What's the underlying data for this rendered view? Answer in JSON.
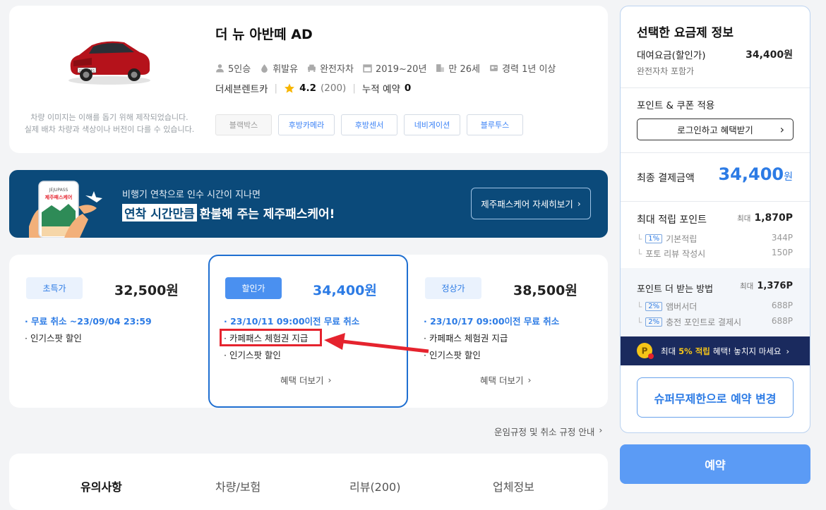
{
  "car": {
    "title": "더 뉴 아반떼 AD",
    "disclaimer_1": "차량 이미지는 이해를 돕기 위해 제작되었습니다.",
    "disclaimer_2": "실제 배차 차량과 색상이나 버전이 다를 수 있습니다.",
    "plate": "22호 2061",
    "specs": [
      "5인승",
      "휘발유",
      "완전자차",
      "2019~20년",
      "만 26세",
      "경력 1년 이상"
    ],
    "company": "더세븐렌트카",
    "rating": "4.2",
    "reviews": "(200)",
    "reservations_label": "누적 예약",
    "reservations_count": "0",
    "tags": [
      "블랙박스",
      "후방카메라",
      "후방센서",
      "네비게이션",
      "블루투스"
    ]
  },
  "banner": {
    "sub": "비행기 연착으로 인수 시간이 지나면",
    "highlight": "연착 시간만큼",
    "main_rest": "환불해 주는 제주패스케어!",
    "button": "제주패스케어 자세히보기",
    "phone_brand": "JEJUPASS",
    "phone_title": "제주패스케어"
  },
  "plans": [
    {
      "label": "초특가",
      "price": "32,500원",
      "lines": [
        "· 무료 취소 ~23/09/04 23:59",
        "· 인기스팟 할인"
      ]
    },
    {
      "label": "할인가",
      "price": "34,400원",
      "lines": [
        "· 23/10/11 09:00이전 무료 취소",
        "· 카페패스 체험권 지급",
        "· 인기스팟 할인"
      ],
      "more": "혜택 더보기"
    },
    {
      "label": "정상가",
      "price": "38,500원",
      "lines": [
        "· 23/10/17 09:00이전 무료 취소",
        "· 카페패스 체험권 지급",
        "· 인기스팟 할인"
      ],
      "more": "혜택 더보기"
    }
  ],
  "policy_link": "운임규정 및 취소 규정 안내",
  "tabs": [
    "유의사항",
    "차량/보험",
    "리뷰(200)",
    "업체정보"
  ],
  "sidebar": {
    "title": "선택한 요금제 정보",
    "fee_label": "대여요금(할인가)",
    "fee_value": "34,400원",
    "fee_note": "완전자차 포함가",
    "coupon_title": "포인트 & 쿠폰 적용",
    "login_btn": "로그인하고 혜택받기",
    "final_label": "최종 결제금액",
    "final_value": "34,400",
    "final_unit": "원",
    "points_title": "최대 적립 포인트",
    "points_max_label": "최대",
    "points_max": "1,870P",
    "points_rows": [
      {
        "pct": "1%",
        "label": "기본적립",
        "value": "344P"
      },
      {
        "pct": "",
        "label": "포토 리뷰 작성시",
        "value": "150P"
      }
    ],
    "more_title": "포인트 더 받는 방법",
    "more_max_label": "최대",
    "more_max": "1,376P",
    "more_rows": [
      {
        "pct": "2%",
        "label": "앰버서더",
        "value": "688P"
      },
      {
        "pct": "2%",
        "label": "충전 포인트로 결제시",
        "value": "688P"
      }
    ],
    "promo_pre": "최대",
    "promo_hl": "5% 적립",
    "promo_post": "혜택! 놓치지 마세요",
    "change_btn": "슈퍼무제한으로 예약 변경",
    "reserve_btn": "예약"
  },
  "colors": {
    "accent": "#2c7be5",
    "annotation": "#e5232e",
    "banner": "#0b4a7a",
    "promo": "#1a2a5e"
  }
}
